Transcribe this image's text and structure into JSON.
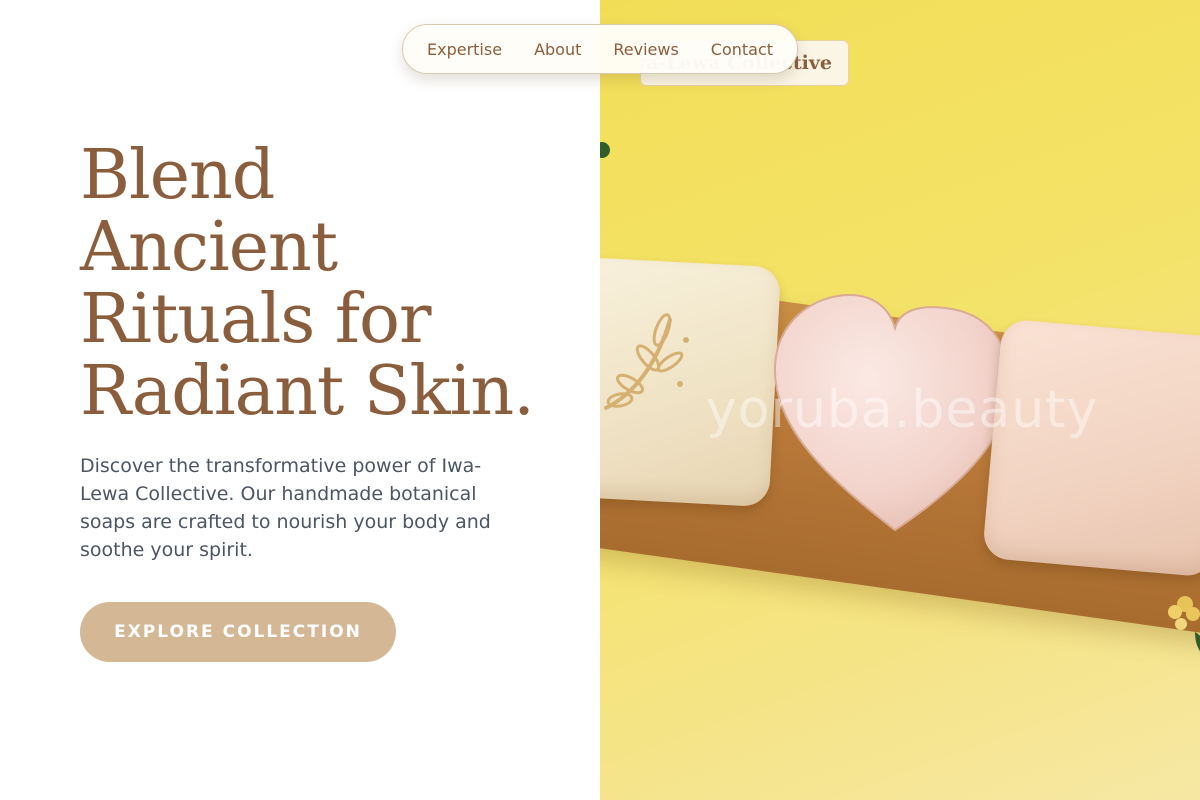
{
  "nav": {
    "items": [
      {
        "label": "Expertise"
      },
      {
        "label": "About"
      },
      {
        "label": "Reviews"
      },
      {
        "label": "Contact"
      }
    ]
  },
  "brand": {
    "name": "Iwa-Lewa Collective"
  },
  "hero": {
    "headline_lines": [
      "Blend",
      "Ancient",
      "Rituals for",
      "Radiant Skin."
    ],
    "description": "Discover the transformative power of Iwa-Lewa Collective. Our handmade botanical soaps are crafted to nourish your body and soothe your spirit.",
    "cta_label": "EXPLORE COLLECTION"
  },
  "image": {
    "watermark": "yoruba.beauty"
  },
  "colors": {
    "brand_brown": "#8a5e3c",
    "cta_tan": "#d4b896",
    "body_text": "#4b5563",
    "panel_yellow": "#f2de56"
  }
}
